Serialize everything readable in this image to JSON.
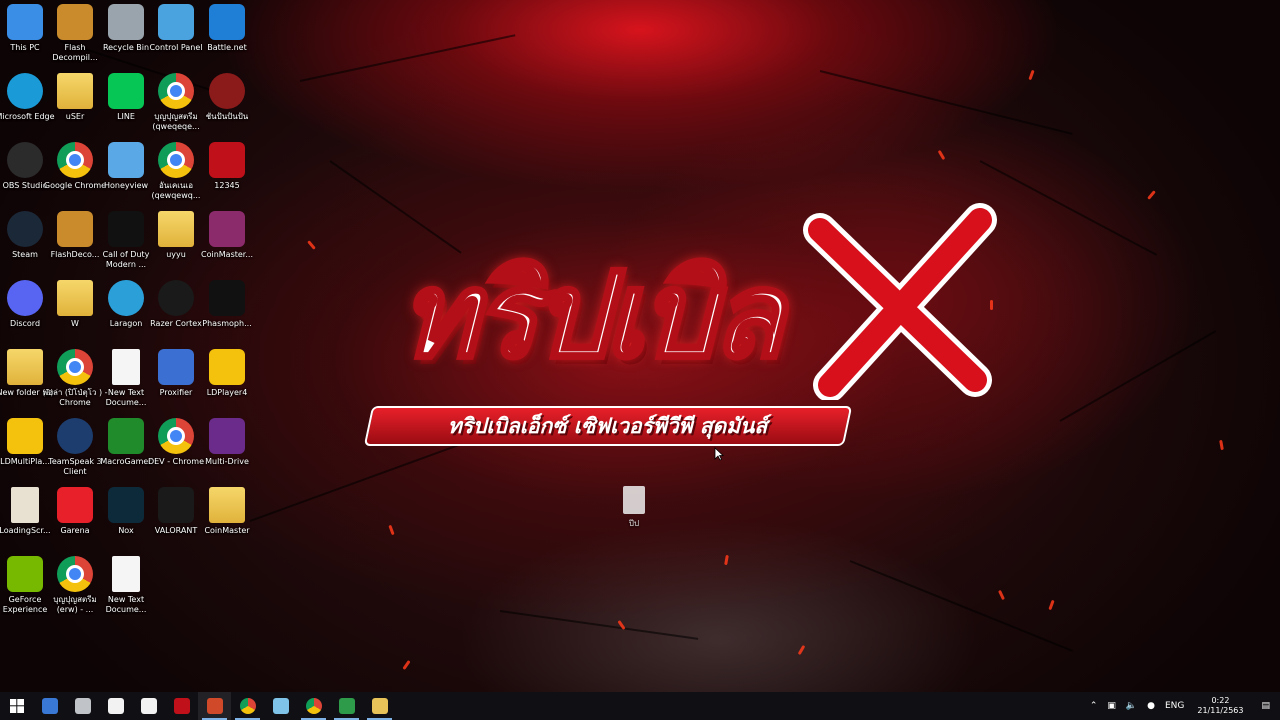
{
  "wallpaper": {
    "logo_title": "ทริปเบิล",
    "logo_x": "X",
    "logo_subtitle": "ทริปเบิลเอ็กซ์ เซิฟเวอร์พีวีพี สุดมันส์"
  },
  "desktop": {
    "icons": [
      {
        "label": "This PC",
        "icon": "computer-icon",
        "color": "#3a8ee6"
      },
      {
        "label": "Flash Decompil...",
        "icon": "boxes-icon",
        "color": "#c98b2c"
      },
      {
        "label": "Recycle Bin",
        "icon": "recycle-bin-icon",
        "color": "#9aa4ad"
      },
      {
        "label": "Control Panel",
        "icon": "control-panel-icon",
        "color": "#4aa3df"
      },
      {
        "label": "Battle.net",
        "icon": "battlenet-icon",
        "color": "#1f7fd6"
      },
      {
        "label": "Microsoft Edge",
        "icon": "edge-icon",
        "color": "#1a9ad6"
      },
      {
        "label": "uSEr",
        "icon": "user-folder-icon",
        "color": "#e8c35a"
      },
      {
        "label": "LINE",
        "icon": "line-icon",
        "color": "#06c755"
      },
      {
        "label": "บุญปุญสตรีม (qweqeqe...",
        "icon": "chrome-icon",
        "color": "#db4437"
      },
      {
        "label": "ชั่นปั้นปั้นปั้น",
        "icon": "avatar-icon",
        "color": "#8b1a1a"
      },
      {
        "label": "OBS Studio",
        "icon": "obs-icon",
        "color": "#2b2b2b"
      },
      {
        "label": "Google Chrome",
        "icon": "chrome-icon",
        "color": "#db4437"
      },
      {
        "label": "Honeyview",
        "icon": "honeyview-icon",
        "color": "#5aa9e6"
      },
      {
        "label": "อันเคเนเอ (qewqewq...",
        "icon": "chrome-icon",
        "color": "#db4437"
      },
      {
        "label": "12345",
        "icon": "red-z-icon",
        "color": "#c0101a"
      },
      {
        "label": "Steam",
        "icon": "steam-icon",
        "color": "#1b2838"
      },
      {
        "label": "FlashDeco...",
        "icon": "boxes-icon",
        "color": "#c98b2c"
      },
      {
        "label": "Call of Duty Modern ...",
        "icon": "mw-icon",
        "color": "#111111"
      },
      {
        "label": "uyyu",
        "icon": "folder-icon",
        "color": "#e8c35a"
      },
      {
        "label": "CoinMaster...",
        "icon": "winrar-icon",
        "color": "#8b2b6b"
      },
      {
        "label": "Discord",
        "icon": "discord-icon",
        "color": "#5865f2"
      },
      {
        "label": "W",
        "icon": "folder-image-icon",
        "color": "#e8c35a"
      },
      {
        "label": "Laragon",
        "icon": "laragon-icon",
        "color": "#2a9fd8"
      },
      {
        "label": "Razer Cortex",
        "icon": "razer-icon",
        "color": "#1a1a1a"
      },
      {
        "label": "Phasmoph...",
        "icon": "phasmophobia-icon",
        "color": "#111111"
      },
      {
        "label": "New folder (2)",
        "icon": "folder-icon",
        "color": "#e8c35a"
      },
      {
        "label": "ฟอล่า (ปิโป่ตุโว ) - Chrome",
        "icon": "chrome-icon",
        "color": "#db4437"
      },
      {
        "label": "New Text Docume...",
        "icon": "text-document-icon",
        "color": "#f5f5f5"
      },
      {
        "label": "Proxifier",
        "icon": "proxifier-icon",
        "color": "#3b6fd1"
      },
      {
        "label": "LDPlayer4",
        "icon": "ldplayer-icon",
        "color": "#f4c20d"
      },
      {
        "label": "LDMultiPla...",
        "icon": "ldmultiplayer-icon",
        "color": "#f4c20d"
      },
      {
        "label": "TeamSpeak 3 Client",
        "icon": "teamspeak-icon",
        "color": "#1c3d6e"
      },
      {
        "label": "MacroGamer",
        "icon": "macrogamer-icon",
        "color": "#1f8b2a"
      },
      {
        "label": "DEV - Chrome",
        "icon": "chrome-icon",
        "color": "#db4437"
      },
      {
        "label": "Multi-Drive",
        "icon": "nox-multi-icon",
        "color": "#6b2b8b"
      },
      {
        "label": "LoadingScr...",
        "icon": "image-file-icon",
        "color": "#e8e0d0"
      },
      {
        "label": "Garena",
        "icon": "garena-icon",
        "color": "#e8202a"
      },
      {
        "label": "Nox",
        "icon": "nox-icon",
        "color": "#0d2a3a"
      },
      {
        "label": "VALORANT",
        "icon": "valorant-icon",
        "color": "#1a1a1a"
      },
      {
        "label": "CoinMaster",
        "icon": "folder-icon",
        "color": "#e8c35a"
      },
      {
        "label": "GeForce Experience",
        "icon": "nvidia-icon",
        "color": "#76b900"
      },
      {
        "label": "บุญปุญสตรีม (erw) - ...",
        "icon": "chrome-icon",
        "color": "#db4437"
      },
      {
        "label": "New Text Docume...",
        "icon": "text-document-icon",
        "color": "#f5f5f5"
      }
    ],
    "floating_file_label": "ปีป"
  },
  "taskbar": {
    "apps": [
      {
        "name": "file-explorer-icon",
        "color": "#3a78d6",
        "state": "normal"
      },
      {
        "name": "steam-taskbar-icon",
        "color": "#c0c4c8",
        "state": "normal"
      },
      {
        "name": "document-taskbar-icon",
        "color": "#f2f2f2",
        "state": "normal"
      },
      {
        "name": "document-taskbar-icon",
        "color": "#f2f2f2",
        "state": "normal"
      },
      {
        "name": "red-app-taskbar-icon",
        "color": "#c0101a",
        "state": "normal"
      },
      {
        "name": "game-taskbar-icon",
        "color": "#d04a2a",
        "state": "open"
      },
      {
        "name": "chrome-taskbar-icon",
        "color": "#db4437",
        "state": "active"
      },
      {
        "name": "notepad-taskbar-icon",
        "color": "#7fc4e8",
        "state": "normal"
      },
      {
        "name": "chrome-taskbar-icon",
        "color": "#db4437",
        "state": "active"
      },
      {
        "name": "spreadsheet-taskbar-icon",
        "color": "#2e9b4a",
        "state": "active"
      },
      {
        "name": "folder-taskbar-icon",
        "color": "#e8c35a",
        "state": "active"
      }
    ],
    "tray": {
      "language": "ENG",
      "time": "0:22",
      "date": "21/11/2563"
    }
  }
}
